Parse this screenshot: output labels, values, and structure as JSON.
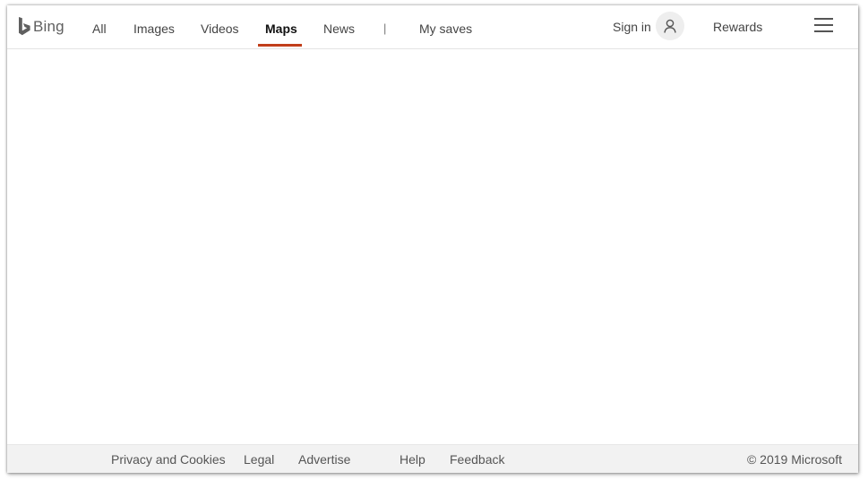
{
  "header": {
    "logo_text": "Bing",
    "nav": [
      {
        "label": "All"
      },
      {
        "label": "Images"
      },
      {
        "label": "Videos"
      },
      {
        "label": "Maps"
      },
      {
        "label": "News"
      },
      {
        "label": "My saves"
      }
    ],
    "active_tab": "Maps",
    "separator": "|",
    "signin_label": "Sign in",
    "rewards_label": "Rewards"
  },
  "footer": {
    "links": [
      {
        "label": "Privacy and Cookies"
      },
      {
        "label": "Legal"
      },
      {
        "label": "Advertise"
      },
      {
        "label": "Help"
      },
      {
        "label": "Feedback"
      }
    ],
    "copyright": "© 2019 Microsoft"
  },
  "colors": {
    "accent": "#c13e1a",
    "logo_gray": "#5f5f5f",
    "footer_bg": "#f2f2f2"
  },
  "icons": {
    "logo": "bing-logo-icon",
    "avatar": "user-icon",
    "menu": "hamburger-menu-icon"
  }
}
